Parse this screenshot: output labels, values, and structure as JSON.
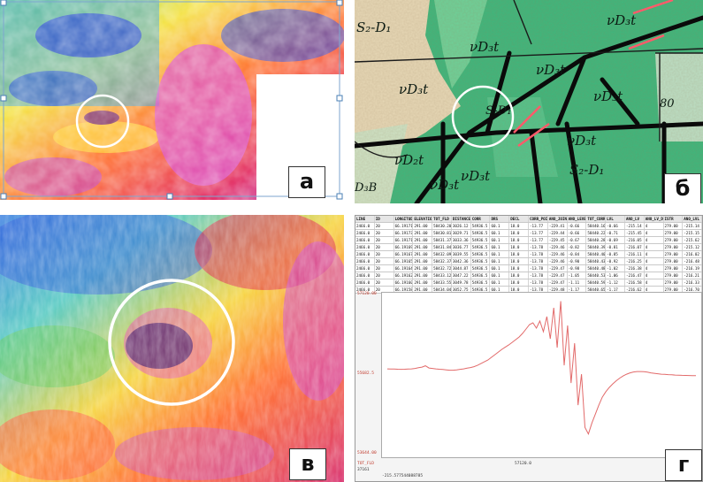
{
  "panels": {
    "a": {
      "label": "а"
    },
    "b": {
      "label": "б",
      "map_labels": [
        "S₂-D₁",
        "νD₃t",
        "νD₃t",
        "νD₃t",
        "νD₃t",
        "νD₃t",
        "νD₃t",
        "νD₃t",
        "S-D₁",
        "S₂-D₁",
        "D₃B",
        "νD₃t",
        "νD₂t",
        "80"
      ]
    },
    "c": {
      "label": "в"
    },
    "d": {
      "label": "г",
      "table_headers": [
        "LINE",
        "ID",
        "LONGITUDE",
        "ELEVATION",
        "TOT_FLD",
        "DISTANCE",
        "CORR",
        "DRS",
        "DECL",
        "CORR_POINT",
        "ANO_JOINT",
        "ANO_LEVEL",
        "TOT_CORR",
        "LVL",
        "ANO_LV",
        "ANO_LV_DIFF",
        "ISTR",
        "ANO_LVL"
      ],
      "table_rows": [
        [
          "2466.0",
          "20",
          "66.19171100",
          "291.00",
          "58430.20",
          "3026.12",
          "54936.5",
          "60.1",
          "18.0",
          "-13.77",
          "-229.41",
          "-0.66",
          "58440.16",
          "-0.66",
          "-215.14",
          "4",
          "279.00",
          "-215.14"
        ],
        [
          "2466.0",
          "20",
          "66.19173110",
          "291.00",
          "58430.81",
          "3029.71",
          "54936.5",
          "60.1",
          "18.0",
          "-13.77",
          "-229.44",
          "-0.66",
          "58440.22",
          "-0.71",
          "-215.45",
          "4",
          "279.00",
          "-215.15"
        ],
        [
          "2466.0",
          "20",
          "66.19171100",
          "291.00",
          "58431.37",
          "3033.36",
          "54936.5",
          "60.1",
          "18.0",
          "-13.77",
          "-229.45",
          "-0.67",
          "58440.28",
          "-0.69",
          "-216.05",
          "4",
          "279.00",
          "-215.62"
        ],
        [
          "2466.0",
          "20",
          "66.19169410",
          "291.00",
          "58431.84",
          "3036.77",
          "54936.5",
          "60.1",
          "18.0",
          "-13.78",
          "-229.46",
          "-0.82",
          "58440.39",
          "-0.81",
          "-216.07",
          "4",
          "279.00",
          "-215.12"
        ],
        [
          "2466.0",
          "20",
          "66.19167330",
          "291.00",
          "58432.09",
          "3039.55",
          "54936.5",
          "60.1",
          "18.0",
          "-13.78",
          "-229.46",
          "-0.84",
          "58440.40",
          "-0.85",
          "-216.11",
          "4",
          "279.00",
          "-216.02"
        ],
        [
          "2466.0",
          "20",
          "66.19165330",
          "291.00",
          "58432.37",
          "3042.36",
          "54936.5",
          "60.1",
          "18.0",
          "-13.78",
          "-229.46",
          "-0.90",
          "58440.43",
          "-0.92",
          "-216.25",
          "4",
          "279.00",
          "-216.48"
        ],
        [
          "2466.0",
          "20",
          "66.19164330",
          "291.00",
          "58432.72",
          "3044.87",
          "54936.5",
          "60.1",
          "18.0",
          "-13.78",
          "-229.47",
          "-0.98",
          "58440.48",
          "-1.02",
          "-216.38",
          "4",
          "279.00",
          "-216.19"
        ],
        [
          "2466.0",
          "20",
          "66.19162330",
          "291.00",
          "58433.12",
          "3047.22",
          "54936.5",
          "60.1",
          "18.0",
          "-13.78",
          "-229.47",
          "-1.05",
          "58440.53",
          "-1.06",
          "-216.47",
          "4",
          "279.00",
          "-216.21"
        ],
        [
          "2466.0",
          "20",
          "66.19160330",
          "291.00",
          "58433.55",
          "3049.78",
          "54936.5",
          "60.1",
          "18.0",
          "-13.78",
          "-229.47",
          "-1.11",
          "58440.59",
          "-1.12",
          "-216.58",
          "4",
          "279.00",
          "-216.33"
        ],
        [
          "2466.0",
          "20",
          "66.19158330",
          "291.00",
          "58434.04",
          "3052.75",
          "54936.5",
          "60.1",
          "18.0",
          "-13.78",
          "-229.48",
          "-1.17",
          "58440.65",
          "-1.17",
          "-216.62",
          "4",
          "279.00",
          "-216.70"
        ]
      ],
      "y_max": "57120.00",
      "y_mid": "55682.5",
      "y_min": "53644.00",
      "status_field": "TOT_FLD",
      "status_mid": "57120.0",
      "status_fid": "37161",
      "status_coord": "-215.577544088785",
      "chart_data": {
        "type": "line",
        "ylim": [
          53644.0,
          57120.0
        ],
        "series": [
          {
            "color": "#e26a6a",
            "values": [
              55520,
              55518,
              55515,
              55512,
              55510,
              55512,
              55515,
              55520,
              55530,
              55545,
              55560,
              55590,
              55540,
              55530,
              55520,
              55512,
              55505,
              55498,
              55490,
              55490,
              55498,
              55510,
              55520,
              55535,
              55550,
              55570,
              55600,
              55640,
              55680,
              55720,
              55780,
              55840,
              55900,
              55960,
              56010,
              56060,
              56120,
              56180,
              56240,
              56320,
              56420,
              56520,
              56560,
              56440,
              56600,
              56360,
              56700,
              56200,
              56900,
              56000,
              57050,
              55600,
              56500,
              55200,
              56100,
              54700,
              55400,
              54200,
              54050,
              54300,
              54500,
              54700,
              54880,
              55000,
              55100,
              55180,
              55250,
              55310,
              55360,
              55400,
              55430,
              55450,
              55460,
              55460,
              55455,
              55445,
              55430,
              55420,
              55410,
              55400,
              55395,
              55390,
              55385,
              55380,
              55378,
              55375,
              55372,
              55370,
              55368,
              55366
            ]
          }
        ]
      }
    }
  }
}
